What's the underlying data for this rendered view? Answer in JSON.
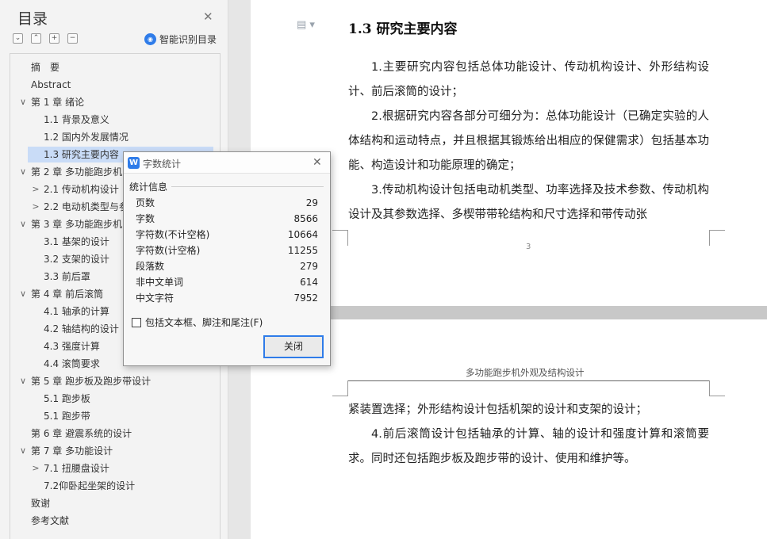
{
  "toc": {
    "title": "目录",
    "close_icon": "close-icon",
    "tools": [
      "collapse-all-icon",
      "expand-level-icon",
      "add-icon",
      "remove-icon"
    ],
    "smart_label": "智能识别目录",
    "items": [
      {
        "label": "摘　要",
        "level": 0,
        "caret": ""
      },
      {
        "label": "Abstract",
        "level": 0,
        "caret": ""
      },
      {
        "label": "第 1 章  绪论",
        "level": 0,
        "caret": "⌄"
      },
      {
        "label": "1.1 背景及意义",
        "level": 1,
        "caret": ""
      },
      {
        "label": "1.2 国内外发展情况",
        "level": 1,
        "caret": ""
      },
      {
        "label": "1.3 研究主要内容",
        "level": 1,
        "caret": "",
        "active": true
      },
      {
        "label": "第 2 章  多功能跑步机",
        "level": 0,
        "caret": "⌄"
      },
      {
        "label": "2.1  传动机构设计",
        "level": 1,
        "caret": "›"
      },
      {
        "label": "2.2  电动机类型与参",
        "level": 1,
        "caret": "›"
      },
      {
        "label": "第 3 章  多功能跑步机",
        "level": 0,
        "caret": "⌄"
      },
      {
        "label": "3.1 基架的设计",
        "level": 1,
        "caret": ""
      },
      {
        "label": "3.2 支架的设计",
        "level": 1,
        "caret": ""
      },
      {
        "label": "3.3 前后罩",
        "level": 1,
        "caret": ""
      },
      {
        "label": "第 4 章  前后滚筒",
        "level": 0,
        "caret": "⌄"
      },
      {
        "label": "4.1 轴承的计算",
        "level": 1,
        "caret": ""
      },
      {
        "label": "4.2 轴结构的设计",
        "level": 1,
        "caret": ""
      },
      {
        "label": "4.3 强度计算",
        "level": 1,
        "caret": ""
      },
      {
        "label": "4.4 滚筒要求",
        "level": 1,
        "caret": ""
      },
      {
        "label": "第 5 章  跑步板及跑步带设计",
        "level": 0,
        "caret": "⌄"
      },
      {
        "label": "5.1 跑步板",
        "level": 1,
        "caret": ""
      },
      {
        "label": "5.1 跑步带",
        "level": 1,
        "caret": ""
      },
      {
        "label": "第 6 章  避震系统的设计",
        "level": 0,
        "caret": ""
      },
      {
        "label": "第 7 章  多功能设计",
        "level": 0,
        "caret": "⌄"
      },
      {
        "label": "7.1 扭腰盘设计",
        "level": 1,
        "caret": "›"
      },
      {
        "label": "7.2仰卧起坐架的设计",
        "level": 1,
        "caret": ""
      },
      {
        "label": "致谢",
        "level": 0,
        "caret": ""
      },
      {
        "label": "参考文献",
        "level": 0,
        "caret": ""
      }
    ]
  },
  "document": {
    "doc_icon": "document-icon",
    "heading": "1.3 研究主要内容",
    "paragraphs": [
      "1.主要研究内容包括总体功能设计、传动机构设计、外形结构设计、前后滚筒的设计；",
      "2.根据研究内容各部分可细分为：总体功能设计（已确定实验的人体结构和运动特点，并且根据其锻炼给出相应的保健需求）包括基本功能、构造设计和功能原理的确定；",
      "3.传动机构设计包括电动机类型、功率选择及技术参数、传动机构设计及其参数选择、多楔带带轮结构和尺寸选择和带传动张"
    ],
    "page_number": "3",
    "running_head": "多功能跑步机外观及结构设计",
    "lower_paragraphs": [
      "紧装置选择；外形结构设计包括机架的设计和支架的设计；",
      "4.前后滚筒设计包括轴承的计算、轴的设计和强度计算和滚筒要求。同时还包括跑步板及跑步带的设计、使用和维护等。"
    ]
  },
  "dialog": {
    "title": "字数统计",
    "logo": "W",
    "section_label": "统计信息",
    "stats": [
      {
        "label": "页数",
        "value": "29"
      },
      {
        "label": "字数",
        "value": "8566"
      },
      {
        "label": "字符数(不计空格)",
        "value": "10664"
      },
      {
        "label": "字符数(计空格)",
        "value": "11255"
      },
      {
        "label": "段落数",
        "value": "279"
      },
      {
        "label": "非中文单词",
        "value": "614"
      },
      {
        "label": "中文字符",
        "value": "7952"
      }
    ],
    "checkbox_label": "包括文本框、脚注和尾注(F)",
    "checkbox_checked": false,
    "close_label": "关闭"
  }
}
